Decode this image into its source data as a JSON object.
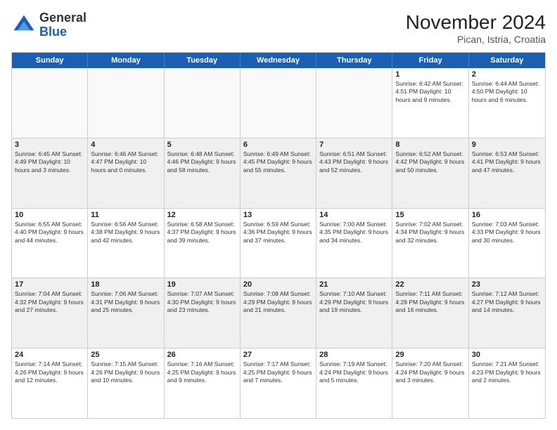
{
  "header": {
    "logo_line1": "General",
    "logo_line2": "Blue",
    "month_title": "November 2024",
    "location": "Pican, Istria, Croatia"
  },
  "days_of_week": [
    "Sunday",
    "Monday",
    "Tuesday",
    "Wednesday",
    "Thursday",
    "Friday",
    "Saturday"
  ],
  "weeks": [
    [
      {
        "day": "",
        "info": "",
        "empty": true
      },
      {
        "day": "",
        "info": "",
        "empty": true
      },
      {
        "day": "",
        "info": "",
        "empty": true
      },
      {
        "day": "",
        "info": "",
        "empty": true
      },
      {
        "day": "",
        "info": "",
        "empty": true
      },
      {
        "day": "1",
        "info": "Sunrise: 6:42 AM\nSunset: 4:51 PM\nDaylight: 10 hours\nand 9 minutes."
      },
      {
        "day": "2",
        "info": "Sunrise: 6:44 AM\nSunset: 4:50 PM\nDaylight: 10 hours\nand 6 minutes."
      }
    ],
    [
      {
        "day": "3",
        "info": "Sunrise: 6:45 AM\nSunset: 4:49 PM\nDaylight: 10 hours\nand 3 minutes."
      },
      {
        "day": "4",
        "info": "Sunrise: 6:46 AM\nSunset: 4:47 PM\nDaylight: 10 hours\nand 0 minutes."
      },
      {
        "day": "5",
        "info": "Sunrise: 6:48 AM\nSunset: 4:46 PM\nDaylight: 9 hours\nand 58 minutes."
      },
      {
        "day": "6",
        "info": "Sunrise: 6:49 AM\nSunset: 4:45 PM\nDaylight: 9 hours\nand 55 minutes."
      },
      {
        "day": "7",
        "info": "Sunrise: 6:51 AM\nSunset: 4:43 PM\nDaylight: 9 hours\nand 52 minutes."
      },
      {
        "day": "8",
        "info": "Sunrise: 6:52 AM\nSunset: 4:42 PM\nDaylight: 9 hours\nand 50 minutes."
      },
      {
        "day": "9",
        "info": "Sunrise: 6:53 AM\nSunset: 4:41 PM\nDaylight: 9 hours\nand 47 minutes."
      }
    ],
    [
      {
        "day": "10",
        "info": "Sunrise: 6:55 AM\nSunset: 4:40 PM\nDaylight: 9 hours\nand 44 minutes."
      },
      {
        "day": "11",
        "info": "Sunrise: 6:56 AM\nSunset: 4:38 PM\nDaylight: 9 hours\nand 42 minutes."
      },
      {
        "day": "12",
        "info": "Sunrise: 6:58 AM\nSunset: 4:37 PM\nDaylight: 9 hours\nand 39 minutes."
      },
      {
        "day": "13",
        "info": "Sunrise: 6:59 AM\nSunset: 4:36 PM\nDaylight: 9 hours\nand 37 minutes."
      },
      {
        "day": "14",
        "info": "Sunrise: 7:00 AM\nSunset: 4:35 PM\nDaylight: 9 hours\nand 34 minutes."
      },
      {
        "day": "15",
        "info": "Sunrise: 7:02 AM\nSunset: 4:34 PM\nDaylight: 9 hours\nand 32 minutes."
      },
      {
        "day": "16",
        "info": "Sunrise: 7:03 AM\nSunset: 4:33 PM\nDaylight: 9 hours\nand 30 minutes."
      }
    ],
    [
      {
        "day": "17",
        "info": "Sunrise: 7:04 AM\nSunset: 4:32 PM\nDaylight: 9 hours\nand 27 minutes."
      },
      {
        "day": "18",
        "info": "Sunrise: 7:06 AM\nSunset: 4:31 PM\nDaylight: 9 hours\nand 25 minutes."
      },
      {
        "day": "19",
        "info": "Sunrise: 7:07 AM\nSunset: 4:30 PM\nDaylight: 9 hours\nand 23 minutes."
      },
      {
        "day": "20",
        "info": "Sunrise: 7:08 AM\nSunset: 4:29 PM\nDaylight: 9 hours\nand 21 minutes."
      },
      {
        "day": "21",
        "info": "Sunrise: 7:10 AM\nSunset: 4:29 PM\nDaylight: 9 hours\nand 19 minutes."
      },
      {
        "day": "22",
        "info": "Sunrise: 7:11 AM\nSunset: 4:28 PM\nDaylight: 9 hours\nand 16 minutes."
      },
      {
        "day": "23",
        "info": "Sunrise: 7:12 AM\nSunset: 4:27 PM\nDaylight: 9 hours\nand 14 minutes."
      }
    ],
    [
      {
        "day": "24",
        "info": "Sunrise: 7:14 AM\nSunset: 4:26 PM\nDaylight: 9 hours\nand 12 minutes."
      },
      {
        "day": "25",
        "info": "Sunrise: 7:15 AM\nSunset: 4:26 PM\nDaylight: 9 hours\nand 10 minutes."
      },
      {
        "day": "26",
        "info": "Sunrise: 7:16 AM\nSunset: 4:25 PM\nDaylight: 9 hours\nand 9 minutes."
      },
      {
        "day": "27",
        "info": "Sunrise: 7:17 AM\nSunset: 4:25 PM\nDaylight: 9 hours\nand 7 minutes."
      },
      {
        "day": "28",
        "info": "Sunrise: 7:19 AM\nSunset: 4:24 PM\nDaylight: 9 hours\nand 5 minutes."
      },
      {
        "day": "29",
        "info": "Sunrise: 7:20 AM\nSunset: 4:24 PM\nDaylight: 9 hours\nand 3 minutes."
      },
      {
        "day": "30",
        "info": "Sunrise: 7:21 AM\nSunset: 4:23 PM\nDaylight: 9 hours\nand 2 minutes."
      }
    ]
  ]
}
